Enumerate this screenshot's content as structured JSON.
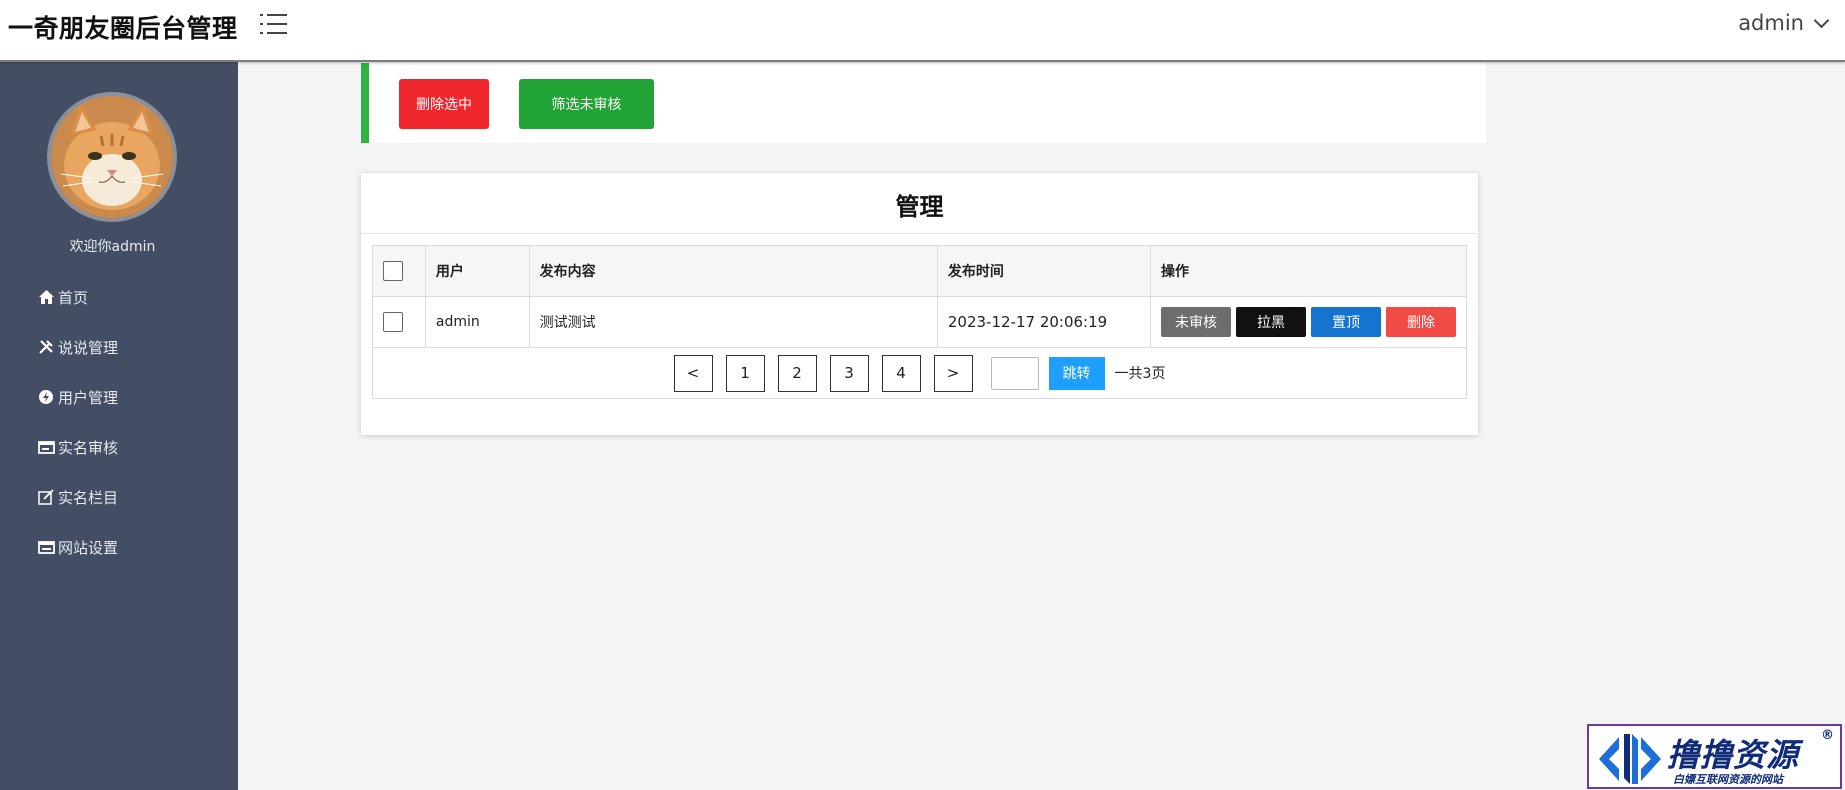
{
  "header": {
    "title": "一奇朋友圈后台管理",
    "user": "admin"
  },
  "sidebar": {
    "welcome": "欢迎你admin",
    "items": [
      {
        "icon": "home-icon",
        "label": "首页"
      },
      {
        "icon": "tools-icon",
        "label": "说说管理"
      },
      {
        "icon": "user-gear-icon",
        "label": "用户管理"
      },
      {
        "icon": "id-card-icon",
        "label": "实名审核"
      },
      {
        "icon": "edit-icon",
        "label": "实名栏目"
      },
      {
        "icon": "window-icon",
        "label": "网站设置"
      }
    ]
  },
  "toolbar": {
    "delete_selected": "删除选中",
    "filter_unreviewed": "筛选未审核"
  },
  "panel": {
    "title": "管理",
    "columns": [
      "用户",
      "发布内容",
      "发布时间",
      "操作"
    ],
    "rows": [
      {
        "user": "admin",
        "content": "测试测试",
        "time": "2023-12-17 20:06:19"
      }
    ],
    "actions": {
      "unreviewed": "未审核",
      "blacklist": "拉黑",
      "pin": "置顶",
      "delete": "删除"
    }
  },
  "pagination": {
    "prev": "<",
    "pages": [
      "1",
      "2",
      "3",
      "4"
    ],
    "next": ">",
    "jump": "跳转",
    "total": "一共3页"
  },
  "watermark": {
    "title": "撸撸资源",
    "subtitle": "白嫖互联网资源的网站",
    "mark": "®"
  },
  "colors": {
    "sidebar": "#434e65",
    "accent_green": "#2fb344",
    "danger": "#f0262d",
    "success": "#21a335",
    "primary": "#1e9fff"
  }
}
